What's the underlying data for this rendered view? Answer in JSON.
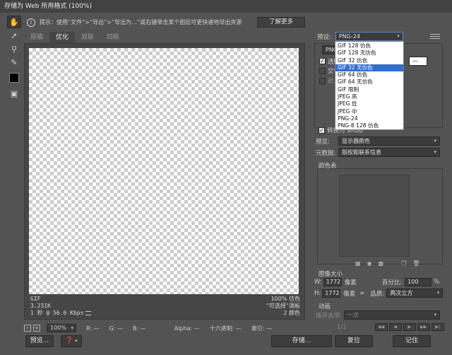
{
  "window": {
    "title": "存储为 Web 所用格式 (100%)"
  },
  "tools": [
    "hand-tool",
    "slice-select-tool",
    "zoom-tool",
    "eyedropper-tool"
  ],
  "hint": {
    "text": "提示：使用“文件”>“导出”>“导出为…”或右键单击某个图层可更快速地导出资源",
    "learn_more": "了解更多"
  },
  "tabs": [
    "原稿",
    "优化",
    "双联",
    "四联"
  ],
  "preview": {
    "format": "GIF",
    "size": "3.231K",
    "speed": "1 秒 @ 56.6 Kbps",
    "quality_pct": "100% 仿色",
    "palette": "“可选择”调板",
    "colors": "2 颜色"
  },
  "status": {
    "zoom": "100%",
    "r": "R: —",
    "g": "G: —",
    "b": "B: —",
    "alpha": "Alpha: —",
    "hex": "十六进制: —",
    "index": "索引: —"
  },
  "buttons": {
    "preview": "预览...",
    "save": "存储...",
    "reset": "复位",
    "remember": "记住"
  },
  "panel": {
    "preset_label": "预设:",
    "preset_value": "PNG-24",
    "format_value": "PNG",
    "transparent_label": "透明",
    "interlaced_label": "交错",
    "matte_label": "嵌入",
    "convert_srgb_label": "转换为 sRGB",
    "preview_label": "预览:",
    "preview_value": "显示器颜色",
    "metadata_label": "元数据:",
    "metadata_value": "版权和联系信息",
    "color_table_label": "颜色表",
    "image_size_label": "图像大小",
    "w_label": "W:",
    "h_label": "H:",
    "width": "1772",
    "height": "1772",
    "unit": "像素",
    "percent_label": "百分比:",
    "percent_value": "100",
    "percent_unit": "%",
    "quality_label": "品质:",
    "quality_value": "两次立方",
    "animation_label": "动画",
    "loop_label": "循环选项:",
    "loop_value": "一次",
    "frame_counter": "1/1"
  },
  "dropdown": {
    "items": [
      "GIF 128 仿色",
      "GIF 128 无仿色",
      "GIF 32 仿色",
      "GIF 32 无仿色",
      "GIF 64 仿色",
      "GIF 64 无仿色",
      "GIF 限制",
      "JPEG 高",
      "JPEG 低",
      "JPEG 中",
      "PNG-24",
      "PNG-8 128 仿色"
    ],
    "selected_index": 3
  },
  "colors": {
    "background": "#535353",
    "selection": "#2f6fd1",
    "titlebar": "#424242"
  }
}
